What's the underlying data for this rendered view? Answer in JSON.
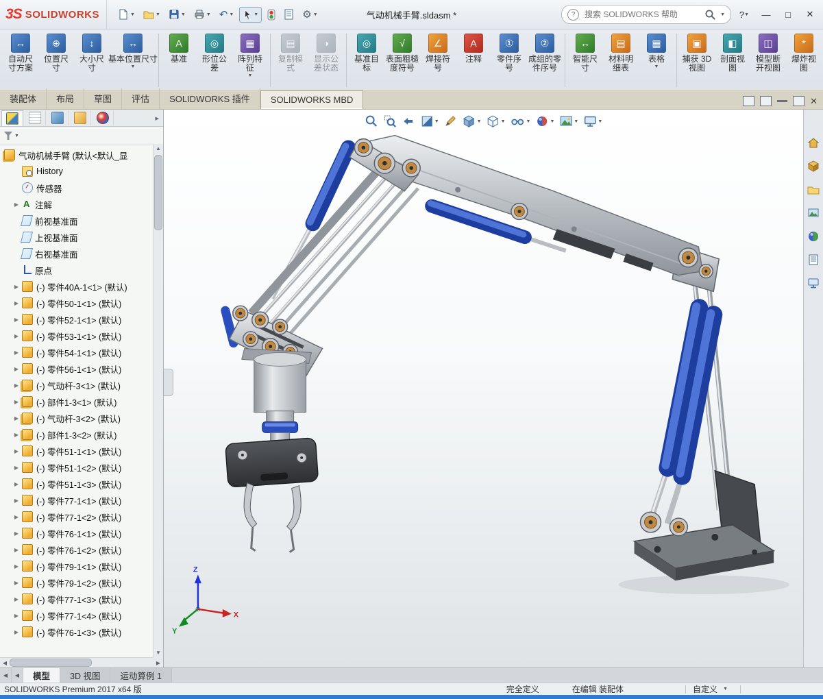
{
  "brand": {
    "mark": "3S",
    "name": "SOLIDWORKS"
  },
  "window": {
    "title": "气动机械手臂.sldasm *",
    "search_placeholder": "搜索 SOLIDWORKS 帮助",
    "help_label": "?",
    "minimize": "—",
    "maximize": "□",
    "close": "✕"
  },
  "titlebar_icons": [
    "new-document-icon",
    "open-icon",
    "save-icon",
    "print-icon",
    "undo-icon",
    "select-cursor-icon",
    "rebuild-icon",
    "file-properties-icon",
    "options-gear-icon"
  ],
  "ribbon_buttons": [
    {
      "name": "auto-dimension-scheme",
      "label": "自动尺\n寸方案",
      "glyph": "↔",
      "c1": "#5a8fd0",
      "c2": "#2c5c9e"
    },
    {
      "name": "location-dimension",
      "label": "位置尺\n寸",
      "glyph": "⊕",
      "c1": "#5a8fd0",
      "c2": "#2c5c9e"
    },
    {
      "name": "size-dimension",
      "label": "大小尺\n寸",
      "glyph": "↕",
      "c1": "#5a8fd0",
      "c2": "#2c5c9e"
    },
    {
      "name": "basic-location-dimension",
      "label": "基本位置尺寸",
      "glyph": "↔",
      "c1": "#5a8fd0",
      "c2": "#2c5c9e",
      "caret": true
    },
    {
      "sep": true
    },
    {
      "name": "datum",
      "label": "基准",
      "glyph": "A",
      "c1": "#63ad4e",
      "c2": "#2f7a2a"
    },
    {
      "name": "geometric-tolerance",
      "label": "形位公\n差",
      "glyph": "◎",
      "c1": "#48a8b0",
      "c2": "#237a84"
    },
    {
      "name": "pattern-feature",
      "label": "阵列特\n征",
      "glyph": "▦",
      "c1": "#8a6fc0",
      "c2": "#5a3f92",
      "caret": true
    },
    {
      "sep": true
    },
    {
      "name": "copy-scheme",
      "label": "复制模\n式",
      "glyph": "▤",
      "c1": "#9aa4ae",
      "c2": "#6a747e",
      "disabled": true
    },
    {
      "name": "show-tolerance-status",
      "label": "显示公\n差状态",
      "glyph": "◑",
      "c1": "#9aa4ae",
      "c2": "#6a747e",
      "disabled": true
    },
    {
      "sep": true
    },
    {
      "name": "datum-target",
      "label": "基准目\n标",
      "glyph": "◎",
      "c1": "#48a8b0",
      "c2": "#237a84"
    },
    {
      "name": "surface-finish",
      "label": "表面粗糙\n度符号",
      "glyph": "√",
      "c1": "#63ad4e",
      "c2": "#2f7a2a"
    },
    {
      "name": "weld-symbol",
      "label": "焊接符\n号",
      "glyph": "∠",
      "c1": "#f0a33c",
      "c2": "#c96a1a"
    },
    {
      "name": "note",
      "label": "注释",
      "glyph": "A",
      "c1": "#e05545",
      "c2": "#b02a20"
    },
    {
      "name": "balloon",
      "label": "零件序\n号",
      "glyph": "①",
      "c1": "#5a8fd0",
      "c2": "#2c5c9e"
    },
    {
      "name": "auto-balloon",
      "label": "成组的零\n件序号",
      "glyph": "②",
      "c1": "#5a8fd0",
      "c2": "#2c5c9e"
    },
    {
      "sep": true
    },
    {
      "name": "smart-dimension",
      "label": "智能尺\n寸",
      "glyph": "↔",
      "c1": "#63ad4e",
      "c2": "#2f7a2a"
    },
    {
      "name": "bill-of-materials",
      "label": "材料明\n细表",
      "glyph": "▤",
      "c1": "#f0a33c",
      "c2": "#c96a1a"
    },
    {
      "name": "tables",
      "label": "表格",
      "glyph": "▦",
      "c1": "#5a8fd0",
      "c2": "#2c5c9e",
      "caret": true
    },
    {
      "sep": true
    },
    {
      "name": "capture-3d-view",
      "label": "捕获 3D\n视图",
      "glyph": "▣",
      "c1": "#f0a33c",
      "c2": "#c96a1a"
    },
    {
      "name": "section-view",
      "label": "剖面视\n图",
      "glyph": "◧",
      "c1": "#48a8b0",
      "c2": "#237a84"
    },
    {
      "name": "model-break-view",
      "label": "模型断\n开视图",
      "glyph": "◫",
      "c1": "#8a6fc0",
      "c2": "#5a3f92"
    },
    {
      "name": "exploded-view",
      "label": "爆炸视\n图",
      "glyph": "*",
      "c1": "#f0a33c",
      "c2": "#c96a1a"
    }
  ],
  "command_tabs": [
    {
      "label": "装配体"
    },
    {
      "label": "布局"
    },
    {
      "label": "草图"
    },
    {
      "label": "评估"
    },
    {
      "label": "SOLIDWORKS 插件"
    },
    {
      "label": "SOLIDWORKS MBD",
      "active": true
    }
  ],
  "tree": {
    "root": "气动机械手臂 (默认<默认_显",
    "items": [
      {
        "icon": "history",
        "label": "History"
      },
      {
        "icon": "sensor",
        "label": "传感器"
      },
      {
        "icon": "ann",
        "label": "注解",
        "exp": true
      },
      {
        "icon": "plane",
        "label": "前视基准面"
      },
      {
        "icon": "plane",
        "label": "上视基准面"
      },
      {
        "icon": "plane",
        "label": "右视基准面"
      },
      {
        "icon": "origin",
        "label": "原点"
      },
      {
        "icon": "part",
        "label": "(-) 零件40A-1<1> (默认)",
        "exp": true
      },
      {
        "icon": "part",
        "label": "(-) 零件50-1<1> (默认)",
        "exp": true
      },
      {
        "icon": "part",
        "label": "(-) 零件52-1<1> (默认)",
        "exp": true
      },
      {
        "icon": "part",
        "label": "(-) 零件53-1<1> (默认)",
        "exp": true
      },
      {
        "icon": "part",
        "label": "(-) 零件54-1<1> (默认)",
        "exp": true
      },
      {
        "icon": "part",
        "label": "(-) 零件56-1<1> (默认)",
        "exp": true
      },
      {
        "icon": "asm",
        "label": "(-) 气动杆-3<1> (默认)",
        "exp": true
      },
      {
        "icon": "asm",
        "label": "(-) 部件1-3<1> (默认)",
        "exp": true
      },
      {
        "icon": "asm",
        "label": "(-) 气动杆-3<2> (默认)",
        "exp": true
      },
      {
        "icon": "asm",
        "label": "(-) 部件1-3<2> (默认)",
        "exp": true
      },
      {
        "icon": "part",
        "label": "(-) 零件51-1<1> (默认)",
        "exp": true
      },
      {
        "icon": "part",
        "label": "(-) 零件51-1<2> (默认)",
        "exp": true
      },
      {
        "icon": "part",
        "label": "(-) 零件51-1<3> (默认)",
        "exp": true
      },
      {
        "icon": "part",
        "label": "(-) 零件77-1<1> (默认)",
        "exp": true
      },
      {
        "icon": "part",
        "label": "(-) 零件77-1<2> (默认)",
        "exp": true
      },
      {
        "icon": "part",
        "label": "(-) 零件76-1<1> (默认)",
        "exp": true
      },
      {
        "icon": "part",
        "label": "(-) 零件76-1<2> (默认)",
        "exp": true
      },
      {
        "icon": "part",
        "label": "(-) 零件79-1<1> (默认)",
        "exp": true
      },
      {
        "icon": "part",
        "label": "(-) 零件79-1<2> (默认)",
        "exp": true
      },
      {
        "icon": "part",
        "label": "(-) 零件77-1<3> (默认)",
        "exp": true
      },
      {
        "icon": "part",
        "label": "(-) 零件77-1<4> (默认)",
        "exp": true
      },
      {
        "icon": "part",
        "label": "(-) 零件76-1<3> (默认)",
        "exp": true
      }
    ]
  },
  "headsup_icons": [
    "zoom-fit-icon",
    "zoom-area-icon",
    "previous-view-icon",
    "section-view-icon",
    "annotation-pencil-icon",
    "view-orientation-icon",
    "display-style-icon",
    "hide-show-items-icon",
    "edit-appearance-icon",
    "apply-scene-icon",
    "view-settings-icon"
  ],
  "taskpane_icons": [
    "home-icon",
    "design-library-icon",
    "file-explorer-icon",
    "view-palette-icon",
    "appearances-icon",
    "custom-properties-icon",
    "forum-icon"
  ],
  "graphics": {
    "triad": {
      "x": "X",
      "y": "Y",
      "z": "Z"
    }
  },
  "doc_tabs": [
    {
      "label": "模型",
      "active": true
    },
    {
      "label": "3D 视图"
    },
    {
      "label": "运动算例 1"
    }
  ],
  "status": {
    "product": "SOLIDWORKS Premium 2017 x64 版",
    "fully_defined": "完全定义",
    "editing": "在编辑 装配体",
    "custom": "自定义"
  }
}
